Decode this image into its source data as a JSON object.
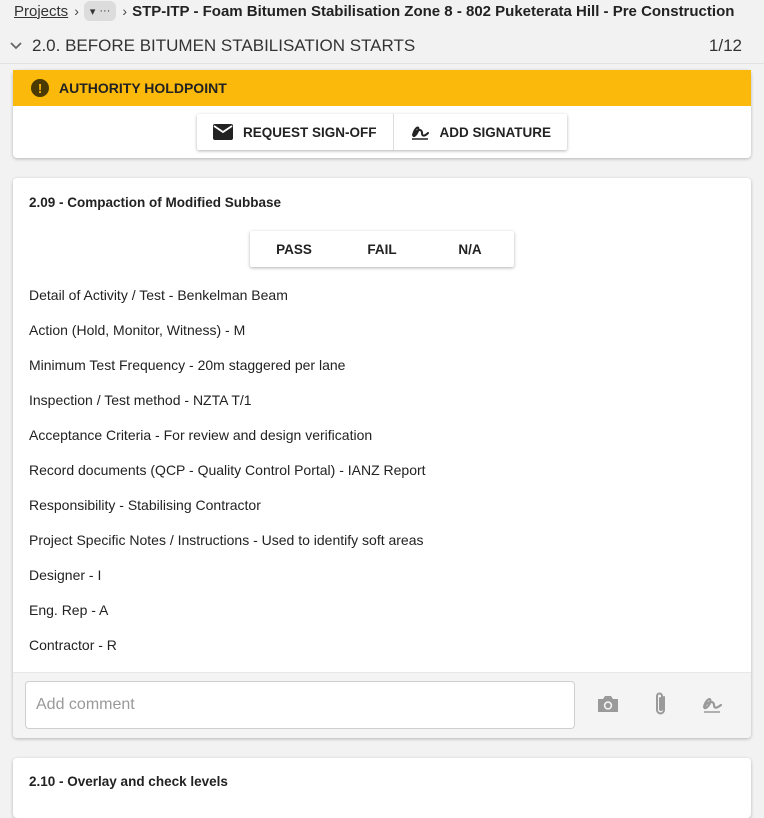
{
  "breadcrumb": {
    "root": "Projects",
    "more": "···",
    "current": "STP-ITP - Foam Bitumen Stabilisation Zone 8 - 802 Puketerata Hill - Pre Construction"
  },
  "section": {
    "title": "2.0. BEFORE BITUMEN STABILISATION STARTS",
    "count": "1/12"
  },
  "holdpoint": {
    "label": "AUTHORITY HOLDPOINT",
    "request_label": "REQUEST SIGN-OFF",
    "signature_label": "ADD SIGNATURE",
    "banner_color": "#fbb90c"
  },
  "item": {
    "title": "2.09 - Compaction of Modified Subbase",
    "options": [
      "PASS",
      "FAIL",
      "N/A"
    ],
    "details": [
      "Detail of Activity / Test - Benkelman Beam",
      "Action (Hold, Monitor, Witness) - M",
      "Minimum Test Frequency - 20m staggered per lane",
      "Inspection / Test method - NZTA T/1",
      "Acceptance Criteria - For review and design verification",
      "Record documents (QCP - Quality Control Portal) - IANZ Report",
      "Responsibility - Stabilising Contractor",
      "Project Specific Notes / Instructions - Used to identify soft areas",
      "Designer - I",
      "Eng. Rep - A",
      "Contractor - R"
    ],
    "comment_placeholder": "Add comment"
  },
  "next_item": {
    "title": "2.10 - Overlay and check levels"
  },
  "icons": [
    "chevron-right-icon",
    "chevron-down-icon",
    "more-icon",
    "alert-icon",
    "mail-icon",
    "signature-icon",
    "camera-icon",
    "paperclip-icon"
  ]
}
